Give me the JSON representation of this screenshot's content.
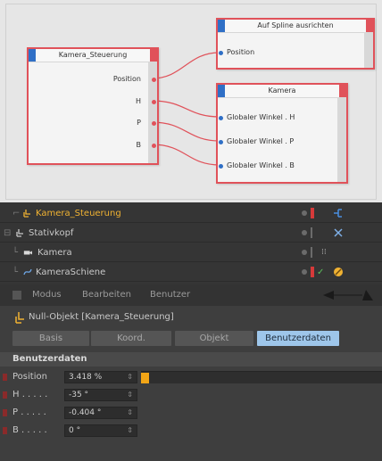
{
  "xpresso": {
    "node_control": {
      "title": "Kamera_Steuerung",
      "ports": [
        "Position",
        "H",
        "P",
        "B"
      ]
    },
    "node_spline": {
      "title": "Auf Spline ausrichten",
      "ports": [
        "Position"
      ]
    },
    "node_camera": {
      "title": "Kamera",
      "ports": [
        "Globaler Winkel . H",
        "Globaler Winkel . P",
        "Globaler Winkel . B"
      ]
    }
  },
  "object_manager": {
    "rows": [
      {
        "name": "Kamera_Steuerung",
        "color": "#f0b232"
      },
      {
        "name": "Stativkopf",
        "color": "#c9c9c9"
      },
      {
        "name": "Kamera",
        "color": "#c9c9c9"
      },
      {
        "name": "KameraSchiene",
        "color": "#c9c9c9"
      }
    ]
  },
  "attribute_manager": {
    "menu": [
      "Modus",
      "Bearbeiten",
      "Benutzer"
    ],
    "object_title": "Null-Objekt [Kamera_Steuerung]",
    "tabs": [
      "Basis",
      "Koord.",
      "Objekt",
      "Benutzerdaten"
    ],
    "active_tab": "Benutzerdaten",
    "section": "Benutzerdaten",
    "params": [
      {
        "label": "Position",
        "value": "3.418 %"
      },
      {
        "label": "H . . . . .",
        "value": "-35 °"
      },
      {
        "label": "P . . . . .",
        "value": "-0.404 °"
      },
      {
        "label": "B . . . . .",
        "value": "0 °"
      }
    ],
    "position_fraction": 0.034
  },
  "colors": {
    "wire": "#e0525a",
    "port_in": "#2f6fc6",
    "active_tab": "#9ec6ea",
    "slider": "#f2a516"
  }
}
